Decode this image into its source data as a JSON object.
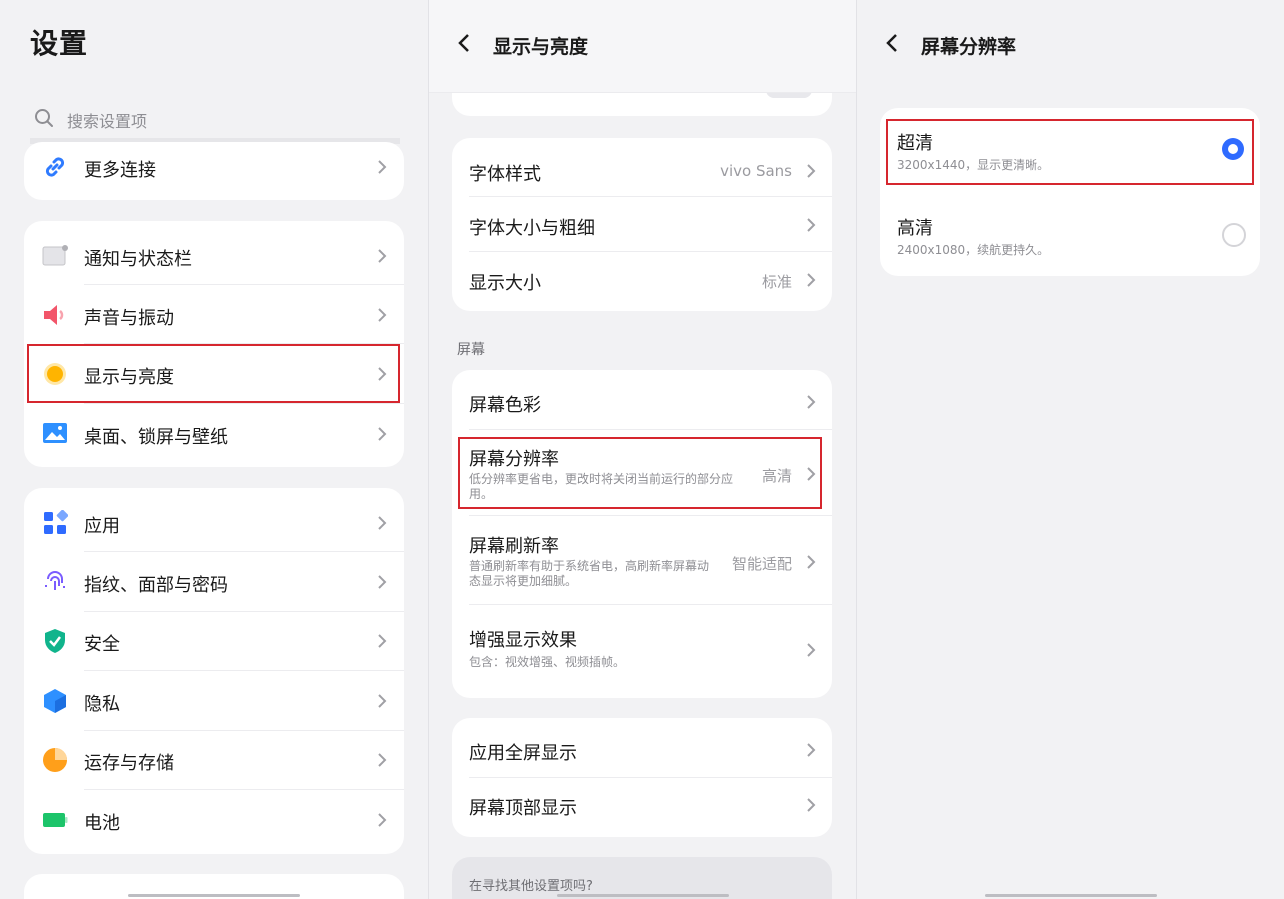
{
  "colors": {
    "accent": "#2f6bff",
    "highlight": "#d6262e",
    "background": "#f2f2f4",
    "card": "#ffffff"
  },
  "panel1": {
    "title": "设置",
    "search_placeholder": "搜索设置项",
    "items": [
      {
        "label": "更多连接",
        "icon": "link-icon"
      },
      {
        "label": "通知与状态栏",
        "icon": "notification-icon"
      },
      {
        "label": "声音与振动",
        "icon": "speaker-icon"
      },
      {
        "label": "显示与亮度",
        "icon": "brightness-icon"
      },
      {
        "label": "桌面、锁屏与壁纸",
        "icon": "wallpaper-icon"
      },
      {
        "label": "应用",
        "icon": "apps-icon"
      },
      {
        "label": "指纹、面部与密码",
        "icon": "fingerprint-icon"
      },
      {
        "label": "安全",
        "icon": "shield-icon"
      },
      {
        "label": "隐私",
        "icon": "privacy-icon"
      },
      {
        "label": "运存与存储",
        "icon": "storage-icon"
      },
      {
        "label": "电池",
        "icon": "battery-icon"
      }
    ]
  },
  "panel2": {
    "title": "显示与亮度",
    "font_style": {
      "label": "字体样式",
      "value": "vivo Sans"
    },
    "font_size": {
      "label": "字体大小与粗细"
    },
    "display_size": {
      "label": "显示大小",
      "value": "标准"
    },
    "section_screen": "屏幕",
    "screen_color": {
      "label": "屏幕色彩"
    },
    "resolution": {
      "label": "屏幕分辨率",
      "sub": "低分辨率更省电，更改时将关闭当前运行的部分应用。",
      "value": "高清"
    },
    "refresh": {
      "label": "屏幕刷新率",
      "sub": "普通刷新率有助于系统省电，高刷新率屏幕动态显示将更加细腻。",
      "value": "智能适配"
    },
    "enhance": {
      "label": "增强显示效果",
      "sub": "包含：视效增强、视频插帧。"
    },
    "fullscreen": {
      "label": "应用全屏显示"
    },
    "top_display": {
      "label": "屏幕顶部显示"
    },
    "other_settings": "在寻找其他设置项吗?"
  },
  "panel3": {
    "title": "屏幕分辨率",
    "options": [
      {
        "label": "超清",
        "sub": "3200x1440，显示更清晰。",
        "selected": true
      },
      {
        "label": "高清",
        "sub": "2400x1080，续航更持久。",
        "selected": false
      }
    ]
  }
}
